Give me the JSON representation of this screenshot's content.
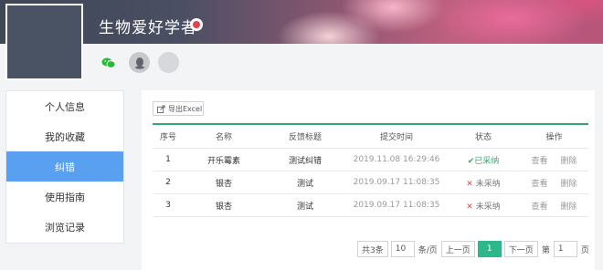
{
  "header": {
    "site_title": "生物爱好学者",
    "social_icons": [
      "wechat-icon",
      "qq-icon",
      "placeholder-icon"
    ]
  },
  "sidebar": {
    "items": [
      {
        "label": "个人信息",
        "active": false
      },
      {
        "label": "我的收藏",
        "active": false
      },
      {
        "label": "纠错",
        "active": true
      },
      {
        "label": "使用指南",
        "active": false
      },
      {
        "label": "浏览记录",
        "active": false
      }
    ]
  },
  "toolbar": {
    "export_label": "导出Excel"
  },
  "table": {
    "headers": [
      "序号",
      "名称",
      "反馈标题",
      "提交时间",
      "状态",
      "操作"
    ],
    "rows": [
      {
        "no": "1",
        "name": "开乐霉素",
        "title": "测试纠错",
        "time": "2019.11.08 16:29:46",
        "status": "已采纳",
        "view": "查看",
        "delete": "删除"
      },
      {
        "no": "2",
        "name": "银杏",
        "title": "测试",
        "time": "2019.09.17 11:08:35",
        "status": "未采纳",
        "view": "查看",
        "delete": "删除"
      },
      {
        "no": "3",
        "name": "银杏",
        "title": "测试",
        "time": "2019.09.17 11:08:35",
        "status": "未采纳",
        "view": "查看",
        "delete": "删除"
      }
    ]
  },
  "pager": {
    "total": "共3条",
    "page_size": "10",
    "per_page_suffix": "条/页",
    "prev": "上一页",
    "current": "1",
    "next": "下一页",
    "goto_prefix": "第",
    "goto_value": "1",
    "goto_suffix": "页"
  },
  "colors": {
    "accent_blue": "#5aa0f0",
    "table_top_border": "#31a86f",
    "pager_active": "#2db88b",
    "status_ok": "#3aa76d",
    "status_no_mark": "#e04848"
  }
}
